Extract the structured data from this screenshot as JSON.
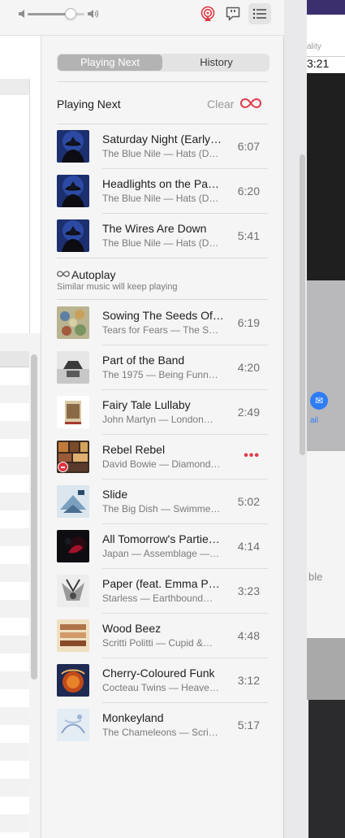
{
  "toolbar": {
    "volume_level": 0.72,
    "airplay_icon": "airplay-icon",
    "lyrics_icon": "lyrics-icon",
    "queue_icon": "queue-list-icon"
  },
  "tabs": [
    {
      "label": "Playing Next",
      "selected": true
    },
    {
      "label": "History",
      "selected": false
    }
  ],
  "playing_next": {
    "title": "Playing Next",
    "clear_label": "Clear"
  },
  "queue": [
    {
      "title": "Saturday Night (Early…",
      "subtitle": "The Blue Nile — Hats (D…",
      "duration": "6:07",
      "art": "hats"
    },
    {
      "title": "Headlights on the Pa…",
      "subtitle": "The Blue Nile — Hats (D…",
      "duration": "6:20",
      "art": "hats"
    },
    {
      "title": "The Wires Are Down",
      "subtitle": "The Blue Nile — Hats (D…",
      "duration": "5:41",
      "art": "hats"
    }
  ],
  "autoplay": {
    "title": "Autoplay",
    "subtitle": "Similar music will keep playing"
  },
  "autoplay_list": [
    {
      "title": "Sowing The Seeds Of…",
      "subtitle": "Tears for Fears — The S…",
      "duration": "6:19",
      "art": "seeds"
    },
    {
      "title": "Part of the Band",
      "subtitle": "The 1975 — Being Funn…",
      "duration": "4:20",
      "art": "band"
    },
    {
      "title": "Fairy Tale Lullaby",
      "subtitle": "John Martyn — London…",
      "duration": "2:49",
      "art": "fairy"
    },
    {
      "title": "Rebel Rebel",
      "subtitle": "David Bowie — Diamond…",
      "duration": "",
      "art": "rebel"
    },
    {
      "title": "Slide",
      "subtitle": "The Big Dish — Swimme…",
      "duration": "5:02",
      "art": "slide"
    },
    {
      "title": "All Tomorrow's Partie…",
      "subtitle": "Japan — Assemblage —…",
      "duration": "4:14",
      "art": "japan"
    },
    {
      "title": "Paper (feat. Emma P…",
      "subtitle": "Starless — Earthbound…",
      "duration": "3:23",
      "art": "paper"
    },
    {
      "title": "Wood Beez",
      "subtitle": "Scritti Politti — Cupid &…",
      "duration": "4:48",
      "art": "wood"
    },
    {
      "title": "Cherry-Coloured Funk",
      "subtitle": "Cocteau Twins — Heave…",
      "duration": "3:12",
      "art": "cherry"
    },
    {
      "title": "Monkeyland",
      "subtitle": "The Chameleons — Scrip…",
      "duration": "5:17",
      "art": "monkey"
    }
  ],
  "background_right": {
    "quality_label": "ality",
    "time_label": "3:21",
    "mail_label": "ail",
    "ble_label": "ble"
  },
  "colors": {
    "accent": "#e03a48",
    "selected_segment": "#b3b3b3"
  }
}
